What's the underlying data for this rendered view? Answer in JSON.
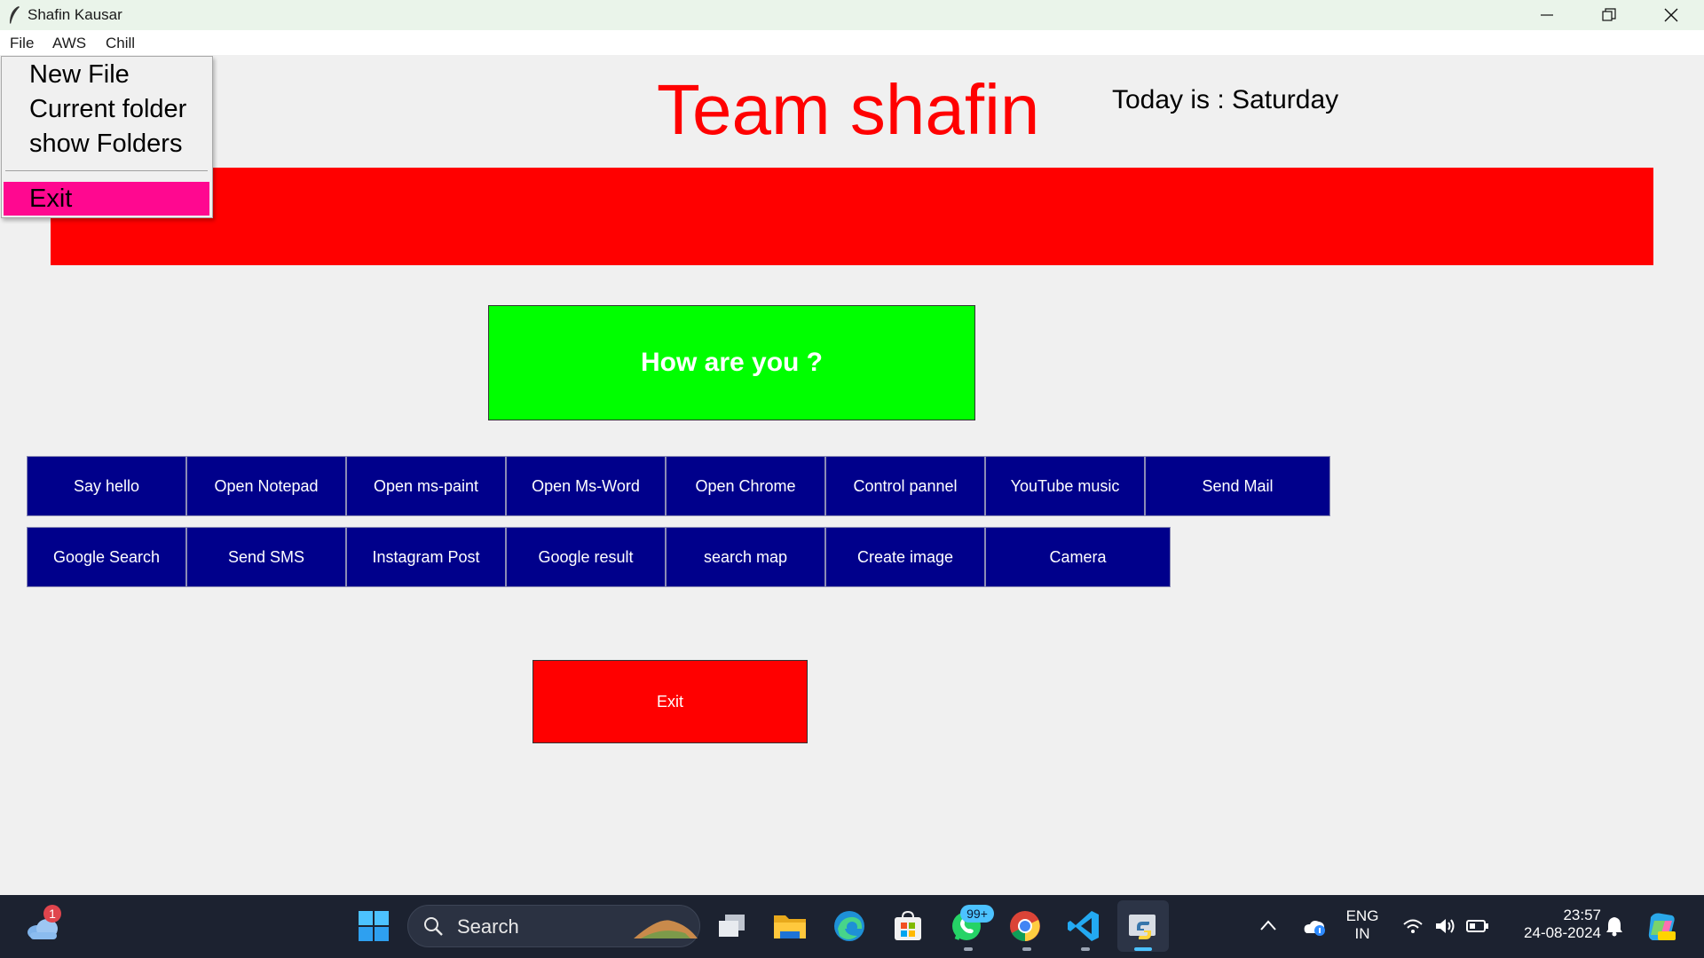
{
  "window": {
    "title": "Shafin Kausar"
  },
  "menubar": {
    "items": [
      "File",
      "AWS",
      "Chill"
    ]
  },
  "file_menu": {
    "items": [
      "New File",
      "Current folder",
      "show Folders"
    ],
    "exit_label": "Exit"
  },
  "header": {
    "title": "Team shafin",
    "today": "Today is : Saturday"
  },
  "how_button": {
    "label": "How are you ?"
  },
  "buttons_row1": [
    "Say hello",
    "Open Notepad",
    "Open ms-paint",
    "Open Ms-Word",
    "Open Chrome",
    "Control pannel",
    "YouTube music",
    "Send Mail"
  ],
  "buttons_row2": [
    "Google Search",
    "Send SMS",
    "Instagram Post",
    "Google result",
    "search map",
    "Create image",
    "Camera"
  ],
  "exit_button": {
    "label": "Exit"
  },
  "taskbar": {
    "search_placeholder": "Search",
    "weather_badge": "1",
    "whatsapp_badge": "99+",
    "lang_primary": "ENG",
    "lang_secondary": "IN",
    "time": "23:57",
    "date": "24-08-2024"
  },
  "colors": {
    "title": "#ff0000",
    "banner": "#ff0000",
    "how_button": "#00ff00",
    "action_buttons": "#00008b",
    "exit_button": "#ff0000",
    "menu_highlight": "#ff0890"
  }
}
